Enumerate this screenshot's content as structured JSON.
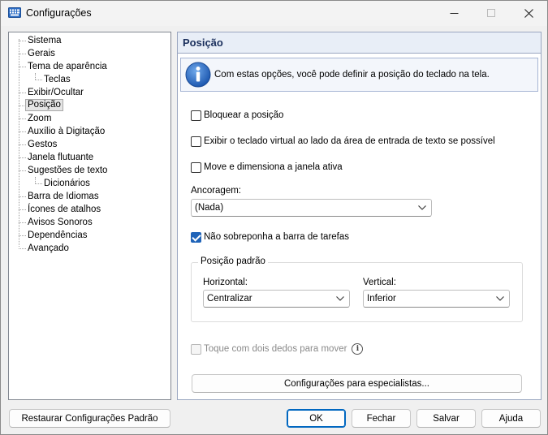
{
  "window": {
    "title": "Configurações"
  },
  "tree": {
    "items": [
      {
        "label": "Sistema",
        "level": 0
      },
      {
        "label": "Gerais",
        "level": 0
      },
      {
        "label": "Tema de aparência",
        "level": 0
      },
      {
        "label": "Teclas",
        "level": 1
      },
      {
        "label": "Exibir/Ocultar",
        "level": 0
      },
      {
        "label": "Posição",
        "level": 0,
        "selected": true
      },
      {
        "label": "Zoom",
        "level": 0
      },
      {
        "label": "Auxílio à Digitação",
        "level": 0
      },
      {
        "label": "Gestos",
        "level": 0
      },
      {
        "label": "Janela flutuante",
        "level": 0
      },
      {
        "label": "Sugestões de texto",
        "level": 0
      },
      {
        "label": "Dicionários",
        "level": 1
      },
      {
        "label": "Barra de Idiomas",
        "level": 0
      },
      {
        "label": "Ícones de atalhos",
        "level": 0
      },
      {
        "label": "Avisos Sonoros",
        "level": 0
      },
      {
        "label": "Dependências",
        "level": 0
      },
      {
        "label": "Avançado",
        "level": 0
      }
    ]
  },
  "panel": {
    "title": "Posição",
    "info": "Com estas opções, você pode definir a posição do teclado na tela.",
    "lock_position": {
      "label": "Bloquear a posição",
      "checked": false
    },
    "show_beside_input": {
      "label": "Exibir o teclado virtual ao lado da área de entrada de texto se possível",
      "checked": false
    },
    "move_resize_active": {
      "label": "Move e dimensiona a janela ativa",
      "checked": false
    },
    "anchoring": {
      "label": "Ancoragem:",
      "value": "(Nada)"
    },
    "no_overlap_taskbar": {
      "label": "Não sobreponha a barra de tarefas",
      "checked": true
    },
    "default_position": {
      "title": "Posição padrão",
      "horizontal": {
        "label": "Horizontal:",
        "value": "Centralizar"
      },
      "vertical": {
        "label": "Vertical:",
        "value": "Inferior"
      }
    },
    "two_finger_move": {
      "label": "Toque com dois dedos para mover",
      "checked": false,
      "disabled": true
    },
    "expert_settings_label": "Configurações para especialistas..."
  },
  "buttons": {
    "restore_defaults": "Restaurar Configurações Padrão",
    "ok": "OK",
    "close": "Fechar",
    "save": "Salvar",
    "help": "Ajuda"
  },
  "colors": {
    "accent": "#0067c0",
    "checkbox_checked": "#1f63b8",
    "panel_title": "#1a2f5c"
  }
}
